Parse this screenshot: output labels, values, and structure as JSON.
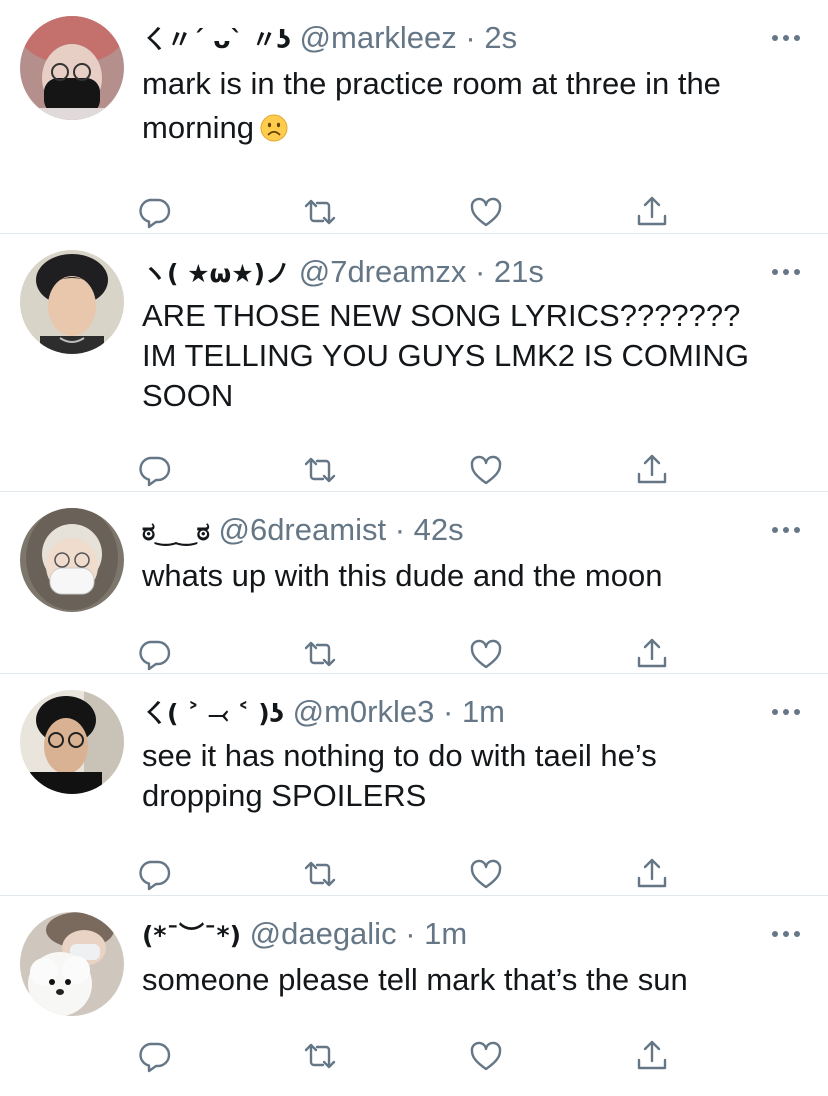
{
  "tweets": [
    {
      "display_name": "ㄑ〃´ ᴗ` 〃ʖ",
      "handle": "@markleez",
      "separator": "·",
      "time": "2s",
      "text": "mark is in the practice room at three in the morning",
      "emoji": "frowning-face"
    },
    {
      "display_name": "ヽ( ★ω★)ノ",
      "handle": "@7dreamzx",
      "separator": "·",
      "time": "21s",
      "text": "ARE THOSE NEW SONG LYRICS??????? IM TELLING YOU GUYS LMK2 IS COMING SOON"
    },
    {
      "display_name": "ಠ‿‿ಠ",
      "handle": "@6dreamist",
      "separator": "·",
      "time": "42s",
      "text": "whats up with this dude and the moon"
    },
    {
      "display_name": "ㄑ( ˃ ⤙ ˂ )ʖ",
      "handle": "@m0rkle3",
      "separator": "·",
      "time": "1m",
      "text": "see it has nothing to do with taeil he’s dropping SPOILERS"
    },
    {
      "display_name": "(*¯︶¯*)",
      "handle": "@daegalic",
      "separator": "·",
      "time": "1m",
      "text": "someone please tell mark that’s the sun"
    }
  ],
  "icons": {
    "reply": "reply-icon",
    "retweet": "retweet-icon",
    "like": "like-icon",
    "share": "share-icon",
    "more": "more-icon"
  },
  "colors": {
    "icon": "#657786",
    "text": "#14171a",
    "muted": "#657786",
    "divider": "#e1e8ed"
  }
}
